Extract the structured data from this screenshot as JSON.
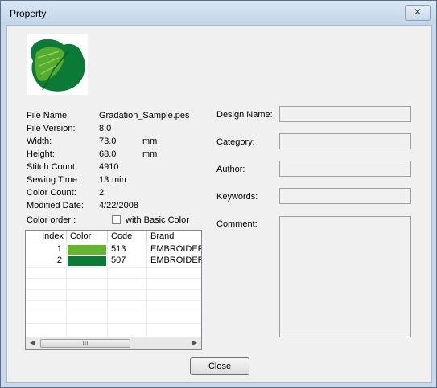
{
  "window": {
    "title": "Property"
  },
  "info": {
    "file_name_label": "File Name:",
    "file_name": "Gradation_Sample.pes",
    "file_version_label": "File Version:",
    "file_version": "8.0",
    "width_label": "Width:",
    "width": "73.0",
    "width_unit": "mm",
    "height_label": "Height:",
    "height": "68.0",
    "height_unit": "mm",
    "stitch_count_label": "Stitch Count:",
    "stitch_count": "4910",
    "sewing_time_label": "Sewing Time:",
    "sewing_time": "13",
    "sewing_time_unit": "min",
    "color_count_label": "Color Count:",
    "color_count": "2",
    "modified_date_label": "Modified Date:",
    "modified_date": "4/22/2008"
  },
  "color_order": {
    "label": "Color order :",
    "basic_color_label": "with Basic Color",
    "basic_color_checked": false,
    "columns": [
      "Index",
      "Color",
      "Code",
      "Brand"
    ],
    "rows": [
      {
        "index": "1",
        "color": "#63b52d",
        "code": "513",
        "brand": "EMBROIDERY"
      },
      {
        "index": "2",
        "color": "#0a7a36",
        "code": "507",
        "brand": "EMBROIDERY"
      }
    ]
  },
  "design": {
    "design_name_label": "Design Name:",
    "design_name": "",
    "category_label": "Category:",
    "category": "",
    "author_label": "Author:",
    "author": "",
    "keywords_label": "Keywords:",
    "keywords": "",
    "comment_label": "Comment:",
    "comment": ""
  },
  "buttons": {
    "close": "Close"
  }
}
